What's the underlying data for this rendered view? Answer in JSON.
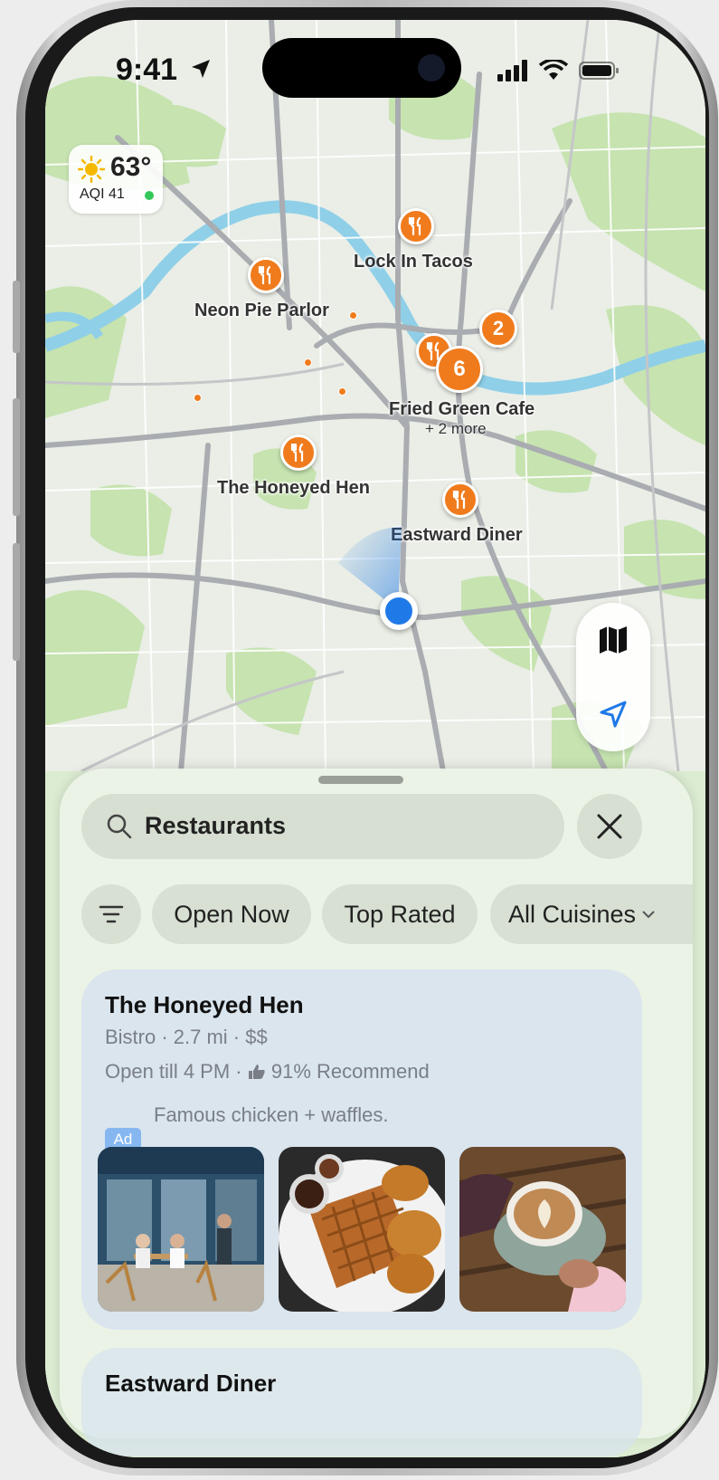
{
  "status_bar": {
    "time": "9:41"
  },
  "weather": {
    "temperature": "63°",
    "aqi": "AQI 41",
    "icon": "sun-icon"
  },
  "map": {
    "places": [
      {
        "name": "Lock In Tacos"
      },
      {
        "name": "Neon Pie Parlor"
      },
      {
        "name": "Fried Green Cafe",
        "extra": "+ 2 more"
      },
      {
        "name": "The Honeyed Hen"
      },
      {
        "name": "Eastward Diner"
      }
    ],
    "clusters": [
      {
        "count": "2"
      },
      {
        "count": "6"
      }
    ]
  },
  "controls": {
    "map_icon": "map-icon",
    "location_icon": "location-arrow-icon"
  },
  "search": {
    "query": "Restaurants"
  },
  "filters": {
    "chips": [
      "Open Now",
      "Top Rated",
      "All Cuisines"
    ]
  },
  "results": [
    {
      "name": "The Honeyed Hen",
      "meta": "Bistro · 2.7 mi ·  $$",
      "hours": "Open till 4 PM · ",
      "recommend": "91% Recommend",
      "ad_label": "Ad",
      "ad_text": "Famous chicken + waffles."
    },
    {
      "name": "Eastward Diner"
    }
  ],
  "colors": {
    "pin": "#f07b1c",
    "user_location": "#1f7ae8",
    "accent": "#1f7ae8"
  }
}
